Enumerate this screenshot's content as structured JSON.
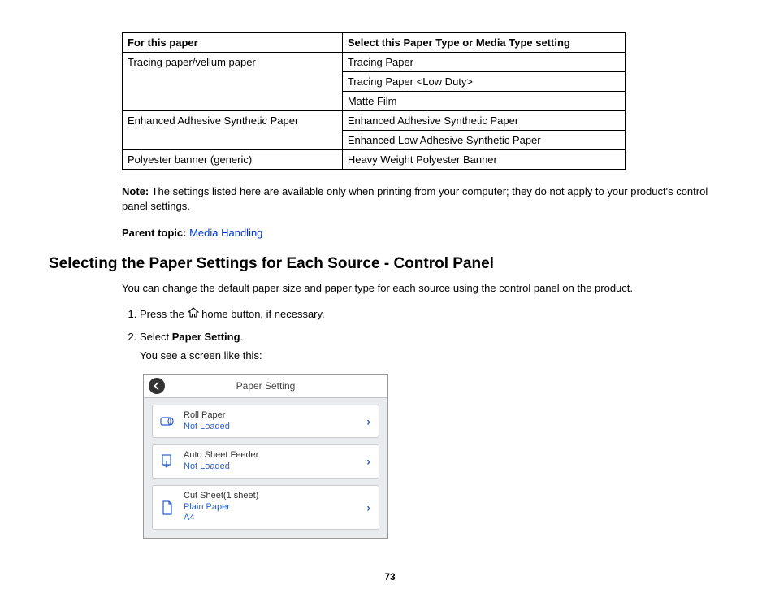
{
  "table": {
    "headers": [
      "For this paper",
      "Select this Paper Type or Media Type setting"
    ],
    "rows": [
      {
        "paper": "Tracing paper/vellum paper",
        "settings": [
          "Tracing Paper",
          "Tracing Paper <Low Duty>",
          "Matte Film"
        ]
      },
      {
        "paper": "Enhanced Adhesive Synthetic Paper",
        "settings": [
          "Enhanced Adhesive Synthetic Paper",
          "Enhanced Low Adhesive Synthetic Paper"
        ]
      },
      {
        "paper": "Polyester banner (generic)",
        "settings": [
          "Heavy Weight Polyester Banner"
        ]
      }
    ]
  },
  "note": {
    "label": "Note:",
    "text": " The settings listed here are available only when printing from your computer; they do not apply to your product's control panel settings."
  },
  "parent_topic": {
    "label": "Parent topic: ",
    "link": "Media Handling"
  },
  "section_heading": "Selecting the Paper Settings for Each Source - Control Panel",
  "intro_text": "You can change the default paper size and paper type for each source using the control panel on the product.",
  "steps": {
    "s1_a": "Press the ",
    "s1_b": " home button, if necessary.",
    "s2_a": "Select ",
    "s2_b": "Paper Setting",
    "s2_c": ".",
    "s2_caption": "You see a screen like this:"
  },
  "screen": {
    "title": "Paper Setting",
    "items": [
      {
        "title": "Roll Paper",
        "line2": "Not Loaded",
        "line3": "",
        "icon": "roll-paper-icon"
      },
      {
        "title": "Auto Sheet Feeder",
        "line2": "Not Loaded",
        "line3": "",
        "icon": "sheet-feeder-icon"
      },
      {
        "title": "Cut Sheet(1 sheet)",
        "line2": "Plain Paper",
        "line3": "A4",
        "icon": "cut-sheet-icon"
      }
    ]
  },
  "page_number": "73"
}
